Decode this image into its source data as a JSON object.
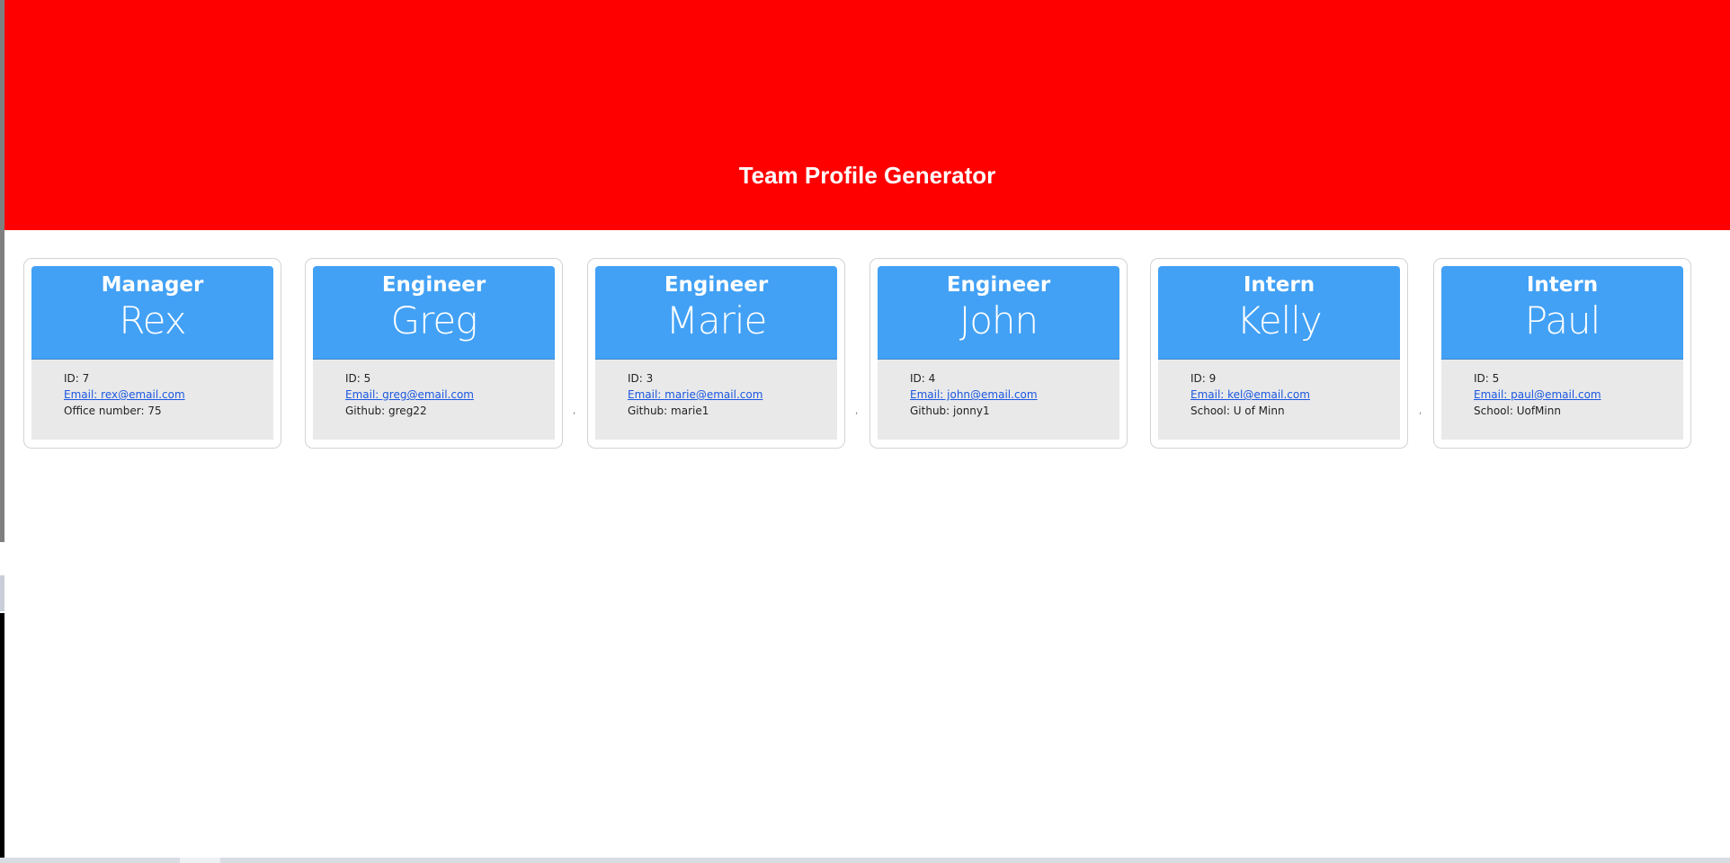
{
  "header": {
    "title": "Team Profile Generator",
    "background_color": "#ff0000"
  },
  "accent_color": "#42a1f5",
  "cards": [
    {
      "role": "Manager",
      "name": "Rex",
      "id": "ID: 7",
      "email": "Email: rex@email.com",
      "extra": "Office number: 75"
    },
    {
      "role": "Engineer",
      "name": "Greg",
      "id": "ID: 5",
      "email": "Email: greg@email.com",
      "extra": "Github: greg22"
    },
    {
      "role": "Engineer",
      "name": "Marie",
      "id": "ID: 3",
      "email": "Email: marie@email.com",
      "extra": "Github: marie1"
    },
    {
      "role": "Engineer",
      "name": "John",
      "id": "ID: 4",
      "email": "Email: john@email.com",
      "extra": "Github: jonny1"
    },
    {
      "role": "Intern",
      "name": "Kelly",
      "id": "ID: 9",
      "email": "Email: kel@email.com",
      "extra": "School: U of Minn"
    },
    {
      "role": "Intern",
      "name": "Paul",
      "id": "ID: 5",
      "email": "Email: paul@email.com",
      "extra": "School: UofMinn"
    }
  ],
  "separator": ","
}
